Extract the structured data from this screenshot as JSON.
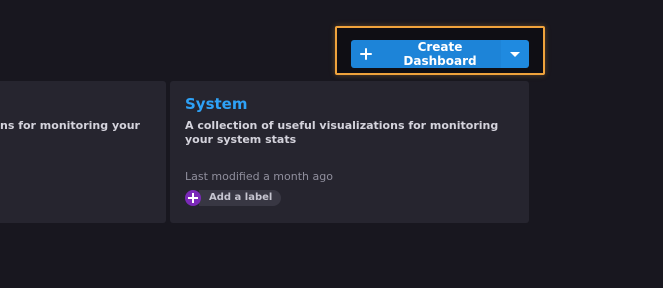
{
  "toolbar": {
    "create_label": "Create Dashboard",
    "create_icon": "plus-icon",
    "dropdown_icon": "caret-down-icon",
    "accent_color": "#1d84d8",
    "highlight_color": "#f0a33c"
  },
  "cards": [
    {
      "title": "",
      "description": "ns for monitoring your"
    },
    {
      "title": "System",
      "description": "A collection of useful visualizations for monitoring your system stats",
      "modified": "Last modified a month ago",
      "add_label": "Add a label",
      "add_label_icon": "plus-circle-icon"
    }
  ]
}
